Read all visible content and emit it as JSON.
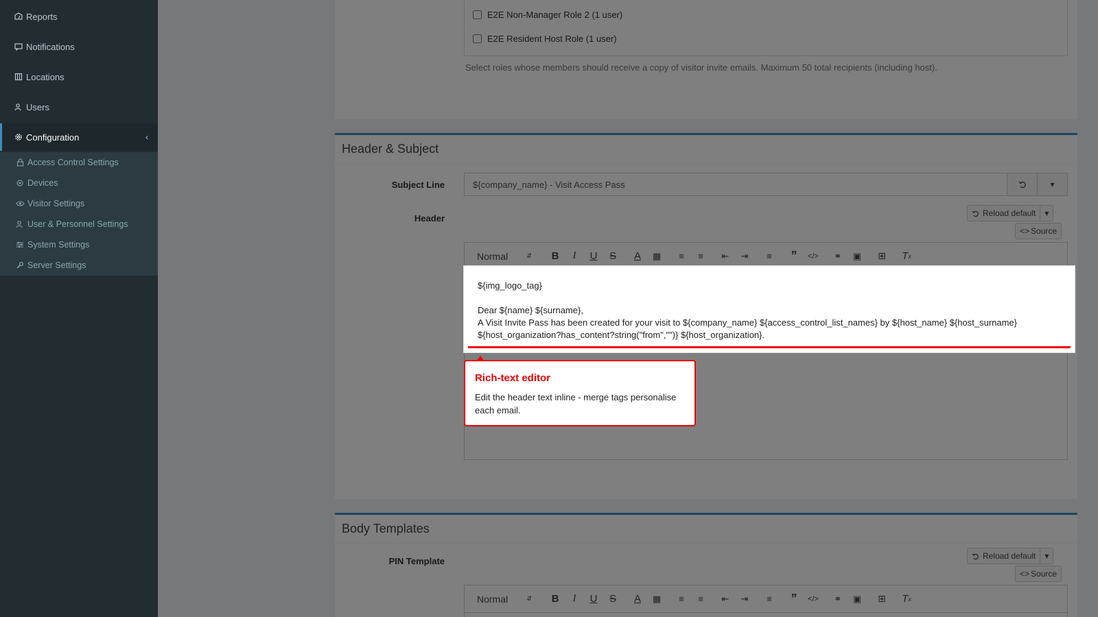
{
  "sidebar": {
    "items": [
      {
        "label": "Reports",
        "icon": "dashboard-icon"
      },
      {
        "label": "Notifications",
        "icon": "chat-icon"
      },
      {
        "label": "Locations",
        "icon": "building-icon"
      },
      {
        "label": "Users",
        "icon": "users-icon"
      },
      {
        "label": "Configuration",
        "icon": "gear-icon"
      }
    ],
    "subitems": [
      {
        "label": "Access Control Settings",
        "icon": "lock-icon"
      },
      {
        "label": "Devices",
        "icon": "device-icon"
      },
      {
        "label": "Visitor Settings",
        "icon": "eye-icon"
      },
      {
        "label": "User & Personnel Settings",
        "icon": "user-cog-icon"
      },
      {
        "label": "System Settings",
        "icon": "sliders-icon"
      },
      {
        "label": "Server Settings",
        "icon": "wrench-icon"
      }
    ]
  },
  "roles": {
    "items": [
      {
        "label": "E2E Non-Manager Role 2 (1 user)"
      },
      {
        "label": "E2E Resident Host Role (1 user)"
      }
    ],
    "help": "Select roles whose members should receive a copy of visitor invite emails. Maximum 50 total recipients (including host)."
  },
  "header_subject": {
    "title": "Header & Subject",
    "subject_label": "Subject Line",
    "subject_value": "${company_name} - Visit Access Pass",
    "header_label": "Header",
    "reload_label": "Reload default",
    "source_label": "Source",
    "format_select": "Normal",
    "editor_lines": [
      "${img_logo_tag}",
      "Dear ${name} ${surname},",
      "A Visit Invite Pass has been created for your visit to ${company_name} ${access_control_list_names} by ${host_name} ${host_surname} ${host_organization?has_content?string(\"from\",\"\")} ${host_organization}."
    ]
  },
  "body_templates": {
    "title": "Body Templates",
    "pin_label": "PIN Template",
    "reload_label": "Reload default",
    "source_label": "Source",
    "format_select": "Normal"
  },
  "tooltip": {
    "title": "Rich-text editor",
    "body": "Edit the header text inline - merge tags personalise each email."
  }
}
